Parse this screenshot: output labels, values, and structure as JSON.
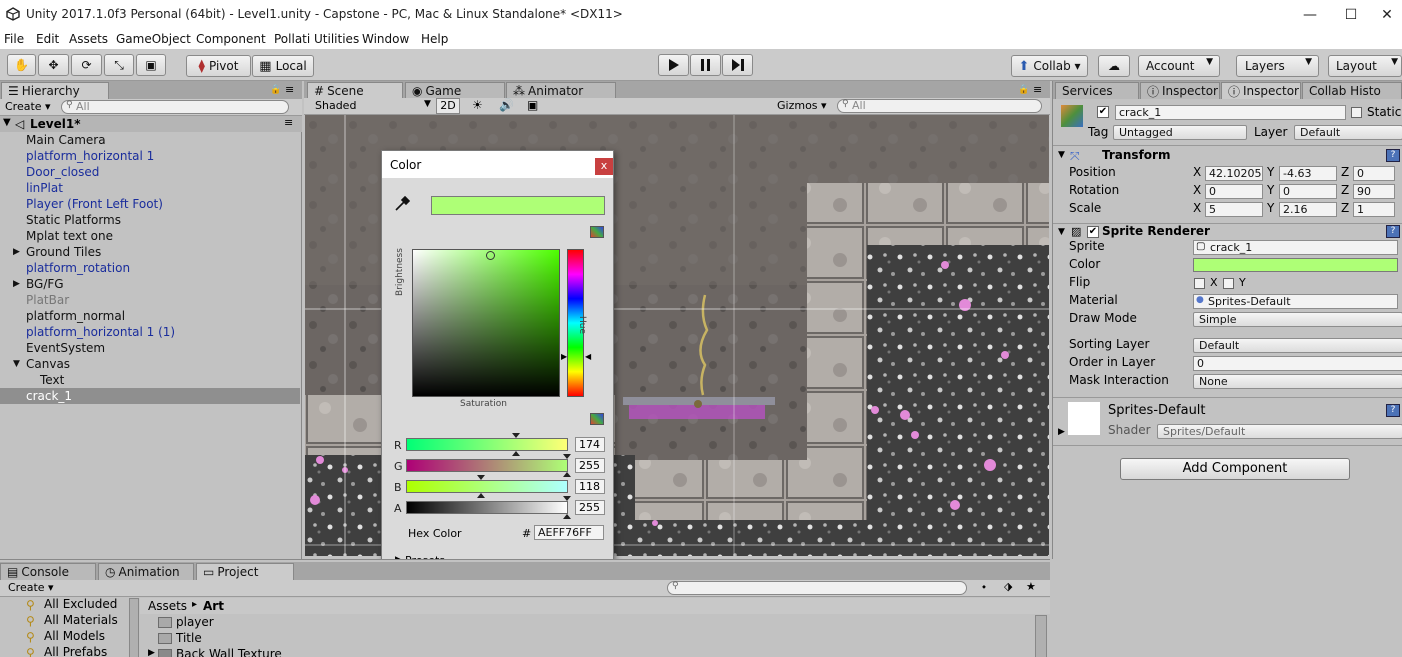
{
  "window": {
    "title": "Unity 2017.1.0f3 Personal (64bit) - Level1.unity - Capstone - PC, Mac & Linux Standalone* <DX11>",
    "minimize": "—",
    "maximize": "☐",
    "close": "✕"
  },
  "menu": [
    "File",
    "Edit",
    "Assets",
    "GameObject",
    "Component",
    "Pollati Utilities",
    "Window",
    "Help"
  ],
  "toolbar": {
    "pivot": "Pivot",
    "local": "Local",
    "collab": "Collab ▾",
    "account": "Account",
    "layers": "Layers",
    "layout": "Layout"
  },
  "hierarchy": {
    "tab": "Hierarchy",
    "create": "Create ▾",
    "search_placeholder": "All",
    "scene": "Level1*",
    "items": [
      {
        "label": "Main Camera",
        "kind": "normal",
        "indent": 1
      },
      {
        "label": "platform_horizontal 1",
        "kind": "prefab",
        "indent": 1
      },
      {
        "label": "Door_closed",
        "kind": "prefab",
        "indent": 1
      },
      {
        "label": "linPlat",
        "kind": "prefab",
        "indent": 1
      },
      {
        "label": "Player (Front Left Foot)",
        "kind": "prefab",
        "indent": 1
      },
      {
        "label": "Static Platforms",
        "kind": "normal",
        "indent": 1
      },
      {
        "label": "Mplat text one",
        "kind": "normal",
        "indent": 1
      },
      {
        "label": "Ground Tiles",
        "kind": "normal",
        "indent": 1,
        "arrow": "▶"
      },
      {
        "label": "platform_rotation",
        "kind": "prefab",
        "indent": 1
      },
      {
        "label": "BG/FG",
        "kind": "normal",
        "indent": 1,
        "arrow": "▶"
      },
      {
        "label": "PlatBar",
        "kind": "disabled",
        "indent": 1
      },
      {
        "label": "platform_normal",
        "kind": "normal",
        "indent": 1
      },
      {
        "label": "platform_horizontal 1 (1)",
        "kind": "prefab",
        "indent": 1
      },
      {
        "label": "EventSystem",
        "kind": "normal",
        "indent": 1
      },
      {
        "label": "Canvas",
        "kind": "normal",
        "indent": 1,
        "arrow": "▼"
      },
      {
        "label": "Text",
        "kind": "normal",
        "indent": 2
      },
      {
        "label": "crack_1",
        "kind": "selected",
        "indent": 1
      }
    ]
  },
  "scene": {
    "tabs": [
      "Scene",
      "Game",
      "Animator"
    ],
    "shaded": "Shaded",
    "mode2d": "2D",
    "gizmos": "Gizmos ▾",
    "search_placeholder": "All"
  },
  "picker": {
    "title": "Color",
    "close": "x",
    "brightness": "Brightness",
    "hue": "Hue",
    "saturation": "Saturation",
    "hex_label": "Hex Color",
    "hex_hash": "#",
    "hex": "AEFF76FF",
    "presets": "Presets",
    "swatch_color": "#aeff76",
    "channels": [
      {
        "label": "R",
        "value": "174",
        "fraction": 0.682
      },
      {
        "label": "G",
        "value": "255",
        "fraction": 1.0
      },
      {
        "label": "B",
        "value": "118",
        "fraction": 0.463
      },
      {
        "label": "A",
        "value": "255",
        "fraction": 1.0
      }
    ]
  },
  "inspector": {
    "tabs": [
      "Services",
      "Inspector",
      "Inspector",
      "Collab Histo"
    ],
    "object_name": "crack_1",
    "static_label": "Static",
    "tag_label": "Tag",
    "tag": "Untagged",
    "layer_label": "Layer",
    "layer": "Default",
    "transform": {
      "title": "Transform",
      "rows": [
        {
          "label": "Position",
          "x": "42.10205",
          "y": "-4.63",
          "z": "0"
        },
        {
          "label": "Rotation",
          "x": "0",
          "y": "0",
          "z": "90"
        },
        {
          "label": "Scale",
          "x": "5",
          "y": "2.16",
          "z": "1"
        }
      ]
    },
    "sprite_renderer": {
      "title": "Sprite Renderer",
      "sprite_label": "Sprite",
      "sprite": "crack_1",
      "color_label": "Color",
      "flip_label": "Flip",
      "flip_x": "X",
      "flip_y": "Y",
      "material_label": "Material",
      "material": "Sprites-Default",
      "draw_mode_label": "Draw Mode",
      "draw_mode": "Simple",
      "sorting_layer_label": "Sorting Layer",
      "sorting_layer": "Default",
      "order_label": "Order in Layer",
      "order": "0",
      "mask_label": "Mask Interaction",
      "mask": "None"
    },
    "material": {
      "name": "Sprites-Default",
      "shader_label": "Shader",
      "shader": "Sprites/Default"
    },
    "add_component": "Add Component"
  },
  "bottom": {
    "tabs": [
      "Console",
      "Animation",
      "Project"
    ],
    "create": "Create ▾",
    "favorites": [
      "All Excluded",
      "All Materials",
      "All Models",
      "All Prefabs"
    ],
    "breadcrumb_root": "Assets",
    "breadcrumb_sep": "▸",
    "breadcrumb_current": "Art",
    "assets": [
      "player",
      "Title",
      "Back Wall Texture"
    ]
  }
}
